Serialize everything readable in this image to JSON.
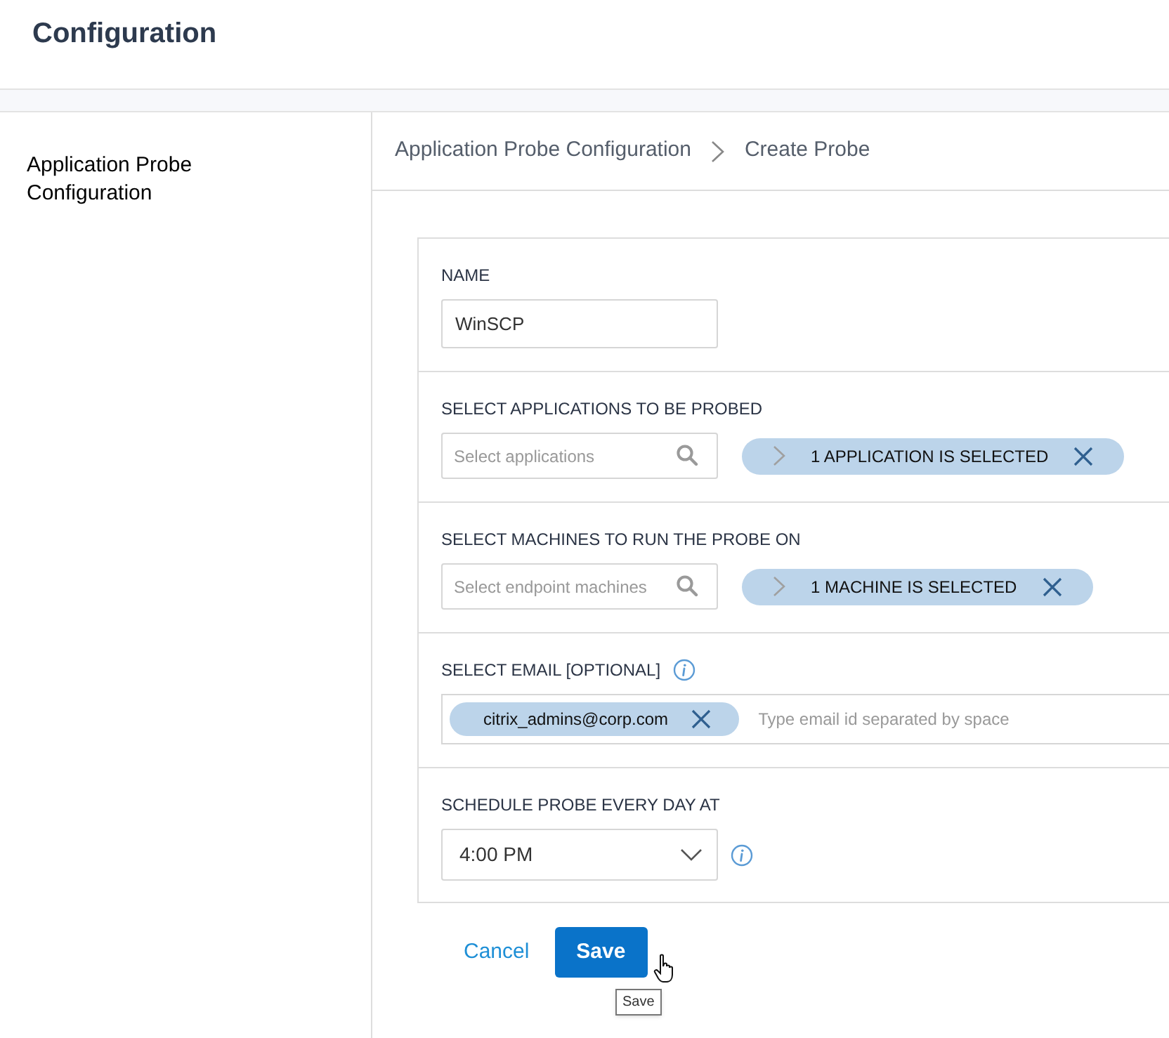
{
  "header": {
    "title": "Configuration"
  },
  "sidebar": {
    "items": [
      {
        "label": "Application Probe Configuration"
      }
    ]
  },
  "breadcrumb": [
    "Application Probe Configuration",
    "Create Probe"
  ],
  "form": {
    "sections": [
      {
        "kind": "text",
        "label": "NAME",
        "value": "WinSCP"
      },
      {
        "kind": "picker",
        "label": "SELECT APPLICATIONS TO BE PROBED",
        "placeholder": "Select applications",
        "chip": "1 APPLICATION IS SELECTED"
      },
      {
        "kind": "picker",
        "label": "SELECT MACHINES TO RUN THE PROBE ON",
        "placeholder": "Select endpoint machines",
        "chip": "1 MACHINE IS SELECTED"
      },
      {
        "kind": "email",
        "label": "SELECT EMAIL [OPTIONAL]",
        "info": true,
        "chips": [
          "citrix_admins@corp.com"
        ],
        "placeholder": "Type email id separated by space"
      },
      {
        "kind": "time",
        "label": "SCHEDULE PROBE EVERY DAY AT",
        "value": "4:00 PM",
        "info": true
      }
    ]
  },
  "actions": {
    "cancel": "Cancel",
    "save": "Save",
    "tooltip": "Save"
  }
}
